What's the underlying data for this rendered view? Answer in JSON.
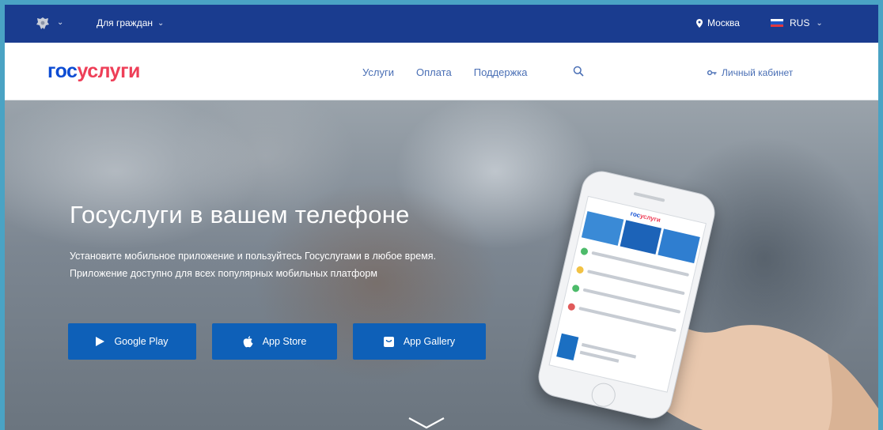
{
  "topbar": {
    "audience_label": "Для граждан",
    "city_label": "Москва",
    "language_label": "RUS"
  },
  "nav": {
    "logo_part1": "гос",
    "logo_part2": "услуги",
    "links": [
      "Услуги",
      "Оплата",
      "Поддержка"
    ],
    "cabinet_label": "Личный кабинет"
  },
  "hero": {
    "title": "Госуслуги в вашем телефоне",
    "subtitle_line1": "Установите мобильное приложение и пользуйтесь Госуслугами в любое время.",
    "subtitle_line2": "Приложение доступно для всех популярных мобильных платформ",
    "buttons": {
      "google_play": "Google Play",
      "app_store": "App Store",
      "app_gallery": "App Gallery"
    }
  },
  "phone_screen": {
    "logo_part1": "гос",
    "logo_part2": "услуги"
  },
  "colors": {
    "topbar_bg": "#1a3c8f",
    "brand_blue": "#0d4cd3",
    "brand_red": "#ee3f58",
    "button_blue": "#0e60b8",
    "nav_link": "#4a6fb5"
  },
  "icons": {
    "emblem": "coat-of-arms-icon",
    "city": "location-pin-icon",
    "language": "russian-flag-icon",
    "search": "search-icon",
    "cabinet": "key-icon",
    "google_play": "play-icon",
    "app_store": "apple-icon",
    "app_gallery": "app-gallery-icon",
    "scroll": "chevron-down-icon"
  }
}
